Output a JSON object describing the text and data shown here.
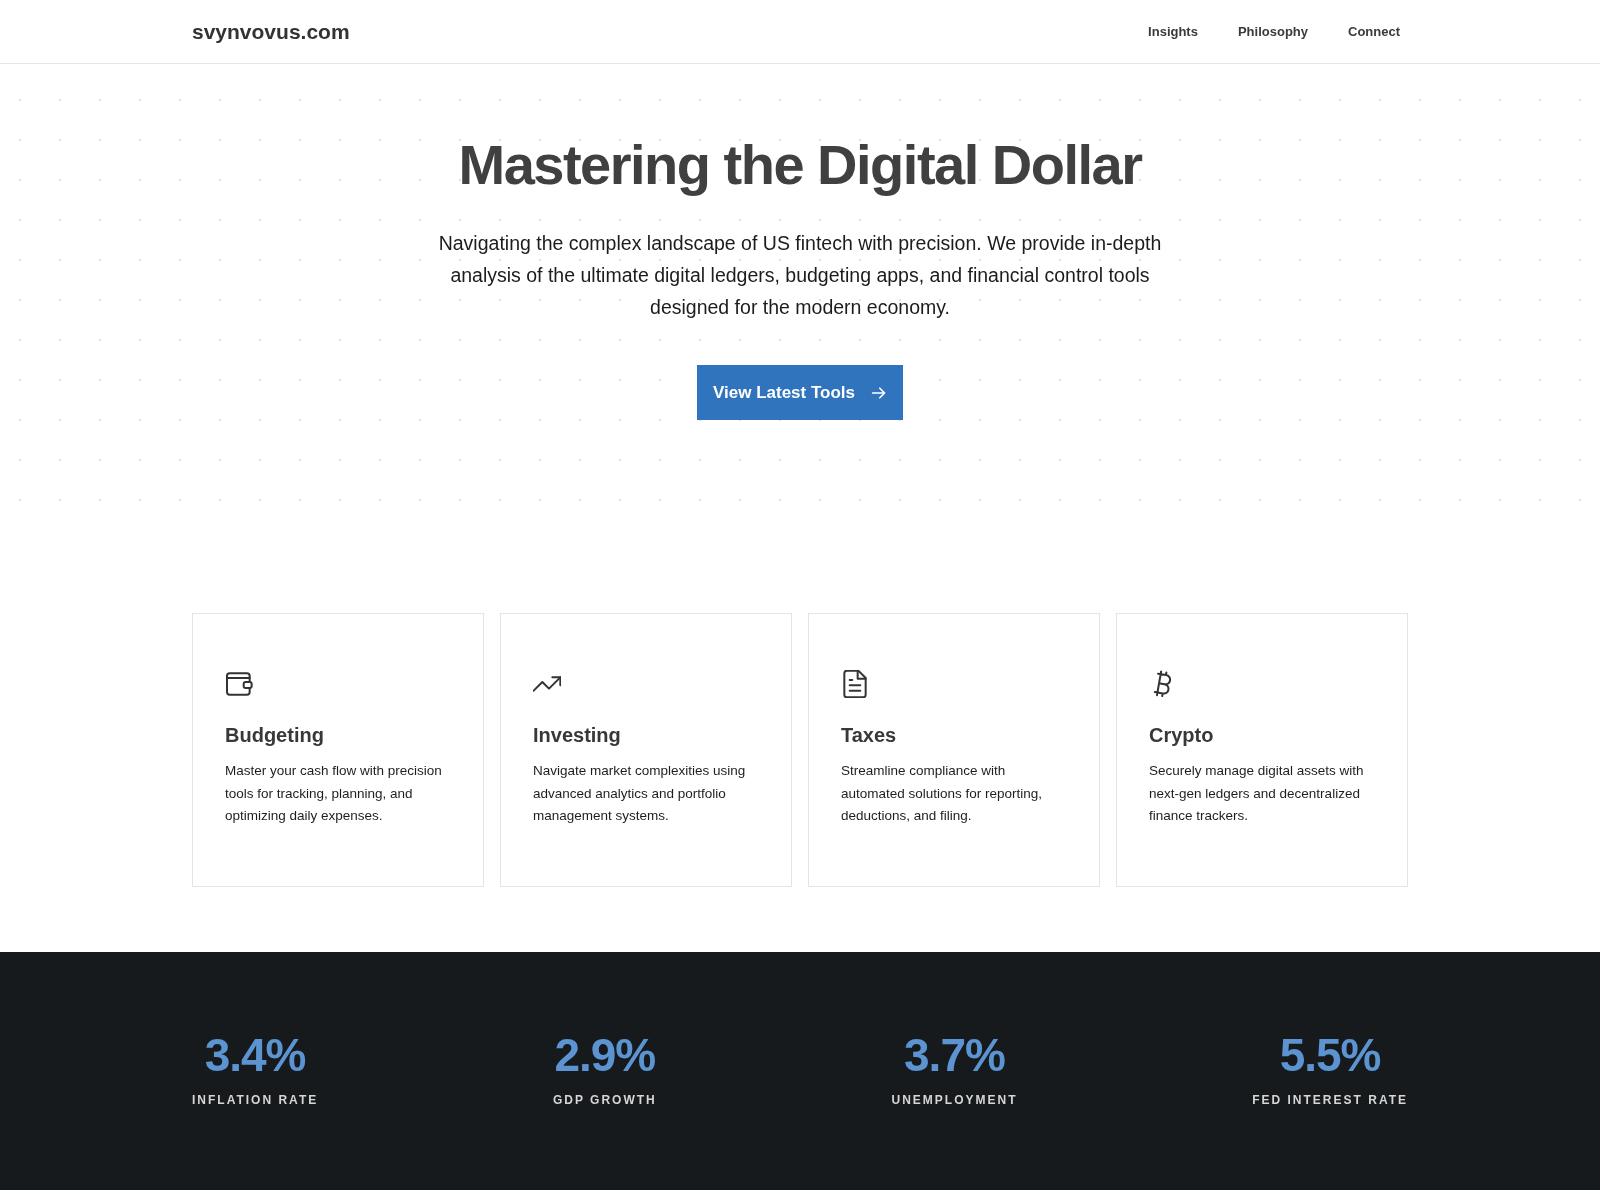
{
  "header": {
    "logo": "svynvovus.com",
    "nav": [
      "Insights",
      "Philosophy",
      "Connect"
    ]
  },
  "hero": {
    "title": "Mastering the Digital Dollar",
    "subtitle": "Navigating the complex landscape of US fintech with precision. We provide in-depth analysis of the ultimate digital ledgers, budgeting apps, and financial control tools designed for the modern economy.",
    "button": "View Latest Tools"
  },
  "features": [
    {
      "title": "Budgeting",
      "description": "Master your cash flow with precision tools for tracking, planning, and optimizing daily expenses."
    },
    {
      "title": "Investing",
      "description": "Navigate market complexities using advanced analytics and portfolio management systems."
    },
    {
      "title": "Taxes",
      "description": "Streamline compliance with automated solutions for reporting, deductions, and filing."
    },
    {
      "title": "Crypto",
      "description": "Securely manage digital assets with next-gen ledgers and decentralized finance trackers."
    }
  ],
  "stats": [
    {
      "value": "3.4%",
      "label": "INFLATION RATE"
    },
    {
      "value": "2.9%",
      "label": "GDP GROWTH"
    },
    {
      "value": "3.7%",
      "label": "UNEMPLOYMENT"
    },
    {
      "value": "5.5%",
      "label": "FED INTEREST RATE"
    }
  ]
}
